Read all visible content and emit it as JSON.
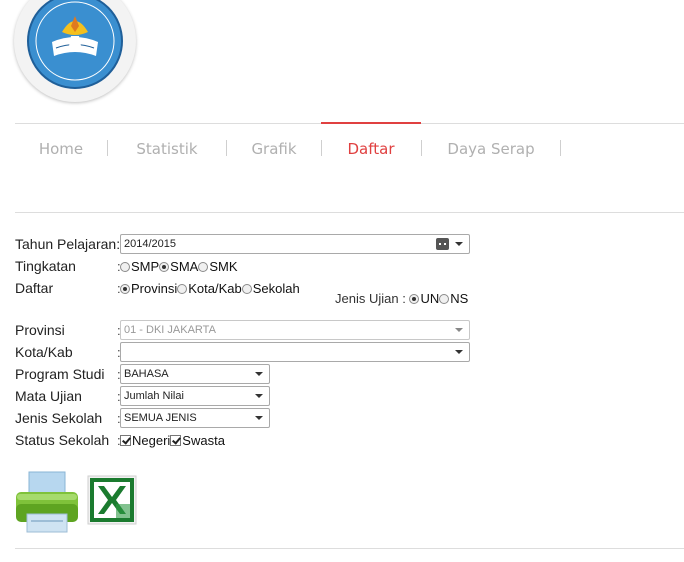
{
  "logo": {
    "text": "TUT WURI HANDAYANI",
    "icon": "tut-wuri-handayani-emblem"
  },
  "nav": {
    "items": [
      {
        "label": "Home",
        "active": false
      },
      {
        "label": "Statistik",
        "active": false
      },
      {
        "label": "Grafik",
        "active": false
      },
      {
        "label": "Daftar",
        "active": true
      },
      {
        "label": "Daya Serap",
        "active": false
      }
    ],
    "active_color": "#e04040"
  },
  "form": {
    "tahun_pelajaran": {
      "label": "Tahun Pelajaran",
      "value": "2014/2015"
    },
    "tingkatan": {
      "label": "Tingkatan",
      "options": [
        {
          "label": "SMP",
          "checked": false
        },
        {
          "label": "SMA",
          "checked": true
        },
        {
          "label": "SMK",
          "checked": false
        }
      ]
    },
    "daftar": {
      "label": "Daftar",
      "options": [
        {
          "label": "Provinsi",
          "checked": true
        },
        {
          "label": "Kota/Kab",
          "checked": false
        },
        {
          "label": "Sekolah",
          "checked": false
        }
      ]
    },
    "jenis_ujian": {
      "label": "Jenis Ujian :",
      "options": [
        {
          "label": "UN",
          "checked": true
        },
        {
          "label": "NS",
          "checked": false
        }
      ]
    },
    "provinsi": {
      "label": "Provinsi",
      "value": "01 - DKI JAKARTA"
    },
    "kota_kab": {
      "label": "Kota/Kab",
      "value": ""
    },
    "program_studi": {
      "label": "Program Studi",
      "value": "BAHASA"
    },
    "mata_ujian": {
      "label": "Mata Ujian",
      "value": "Jumlah Nilai"
    },
    "jenis_sekolah": {
      "label": "Jenis Sekolah",
      "value": "SEMUA JENIS"
    },
    "status_sekolah": {
      "label": "Status Sekolah",
      "options": [
        {
          "label": "Negeri",
          "checked": true
        },
        {
          "label": "Swasta",
          "checked": true
        }
      ]
    },
    "colon": ":"
  },
  "actions": {
    "print_icon": "printer-icon",
    "excel_icon": "excel-icon"
  }
}
